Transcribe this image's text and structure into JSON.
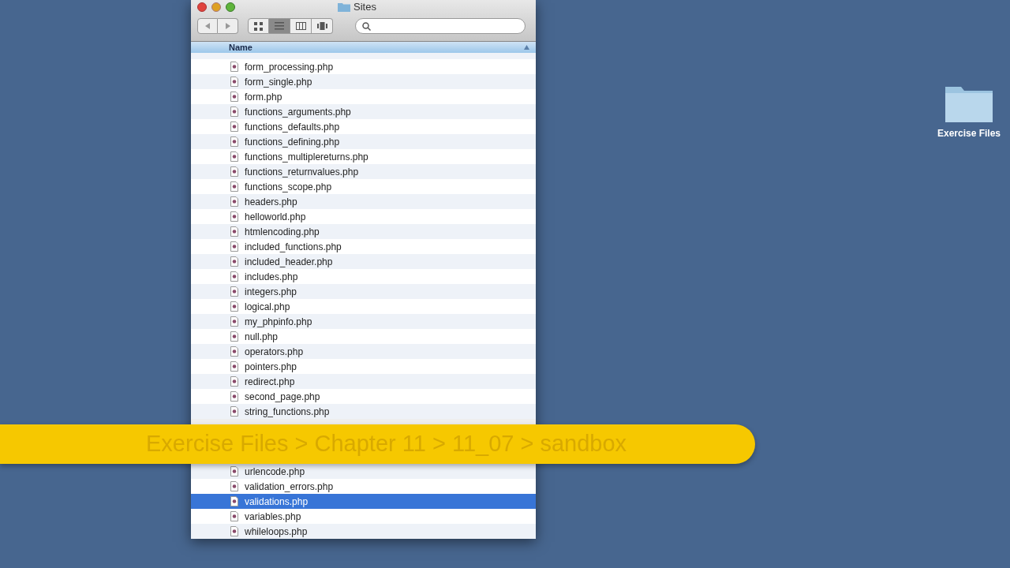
{
  "window": {
    "title": "Sites"
  },
  "view_buttons": [
    {
      "kind": "icons",
      "selected": false
    },
    {
      "kind": "list",
      "selected": true
    },
    {
      "kind": "columns",
      "selected": false
    },
    {
      "kind": "coverflow",
      "selected": false
    }
  ],
  "column_header": "Name",
  "files_above_banner": [
    {
      "name": "form_processing.php",
      "selected": false
    },
    {
      "name": "form_single.php",
      "selected": false
    },
    {
      "name": "form.php",
      "selected": false
    },
    {
      "name": "functions_arguments.php",
      "selected": false
    },
    {
      "name": "functions_defaults.php",
      "selected": false
    },
    {
      "name": "functions_defining.php",
      "selected": false
    },
    {
      "name": "functions_multiplereturns.php",
      "selected": false
    },
    {
      "name": "functions_returnvalues.php",
      "selected": false
    },
    {
      "name": "functions_scope.php",
      "selected": false
    },
    {
      "name": "headers.php",
      "selected": false
    },
    {
      "name": "helloworld.php",
      "selected": false
    },
    {
      "name": "htmlencoding.php",
      "selected": false
    },
    {
      "name": "included_functions.php",
      "selected": false
    },
    {
      "name": "included_header.php",
      "selected": false
    },
    {
      "name": "includes.php",
      "selected": false
    },
    {
      "name": "integers.php",
      "selected": false
    },
    {
      "name": "logical.php",
      "selected": false
    },
    {
      "name": "my_phpinfo.php",
      "selected": false
    },
    {
      "name": "null.php",
      "selected": false
    },
    {
      "name": "operators.php",
      "selected": false
    },
    {
      "name": "pointers.php",
      "selected": false
    },
    {
      "name": "redirect.php",
      "selected": false
    },
    {
      "name": "second_page.php",
      "selected": false
    },
    {
      "name": "string_functions.php",
      "selected": false
    }
  ],
  "files_below_banner": [
    {
      "name": "urlencode.php",
      "selected": false
    },
    {
      "name": "validation_errors.php",
      "selected": false
    },
    {
      "name": "validations.php",
      "selected": true
    },
    {
      "name": "variables.php",
      "selected": false
    },
    {
      "name": "whileloops.php",
      "selected": false
    }
  ],
  "breadcrumb_banner": "Exercise Files > Chapter 11 > 11_07 > sandbox",
  "desktop_items": [
    {
      "label": "Exercise Files"
    }
  ]
}
